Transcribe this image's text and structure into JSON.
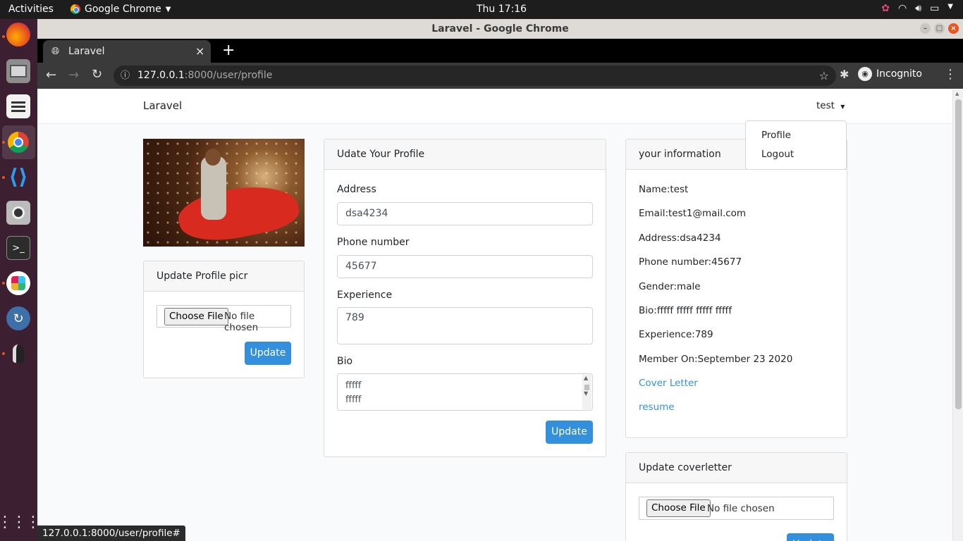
{
  "os": {
    "activities": "Activities",
    "app_name": "Google Chrome",
    "clock": "Thu 17:16"
  },
  "window": {
    "title": "Laravel - Google Chrome",
    "tab_title": "Laravel",
    "url_host": "127.0.0.1",
    "url_rest": ":8000/user/profile",
    "incognito_label": "Incognito",
    "status_url": "127.0.0.1:8000/user/profile#"
  },
  "navbar": {
    "brand": "Laravel",
    "user": "test",
    "menu": [
      "Profile",
      "Logout"
    ]
  },
  "pic_card": {
    "title": "Update Profile picr",
    "choose_label": "Choose File",
    "no_file": "No file chosen",
    "button": "Update"
  },
  "profile_form": {
    "title": "Udate Your Profile",
    "address_label": "Address",
    "address_value": "dsa4234",
    "phone_label": "Phone number",
    "phone_value": "45677",
    "experience_label": "Experience",
    "experience_value": "789",
    "bio_label": "Bio",
    "bio_lines": [
      "fffff",
      "fffff"
    ],
    "button": "Update"
  },
  "info_card": {
    "title": "your information",
    "name": "Name:test",
    "email": "Email:test1@mail.com",
    "address": "Address:dsa4234",
    "phone": "Phone number:45677",
    "gender": "Gender:male",
    "bio": "Bio:fffff fffff fffff fffff",
    "experience": "Experience:789",
    "member_on": "Member On:September 23 2020",
    "cover_letter_link": "Cover Letter",
    "resume_link": "resume"
  },
  "cover_card": {
    "title": "Update coverletter",
    "choose_label": "Choose File",
    "no_file": "No file chosen",
    "button": "Update"
  },
  "colors": {
    "primary": "#3490dc",
    "dock_bg": "#3c1f31",
    "topbar_bg": "#1d1d1d"
  }
}
